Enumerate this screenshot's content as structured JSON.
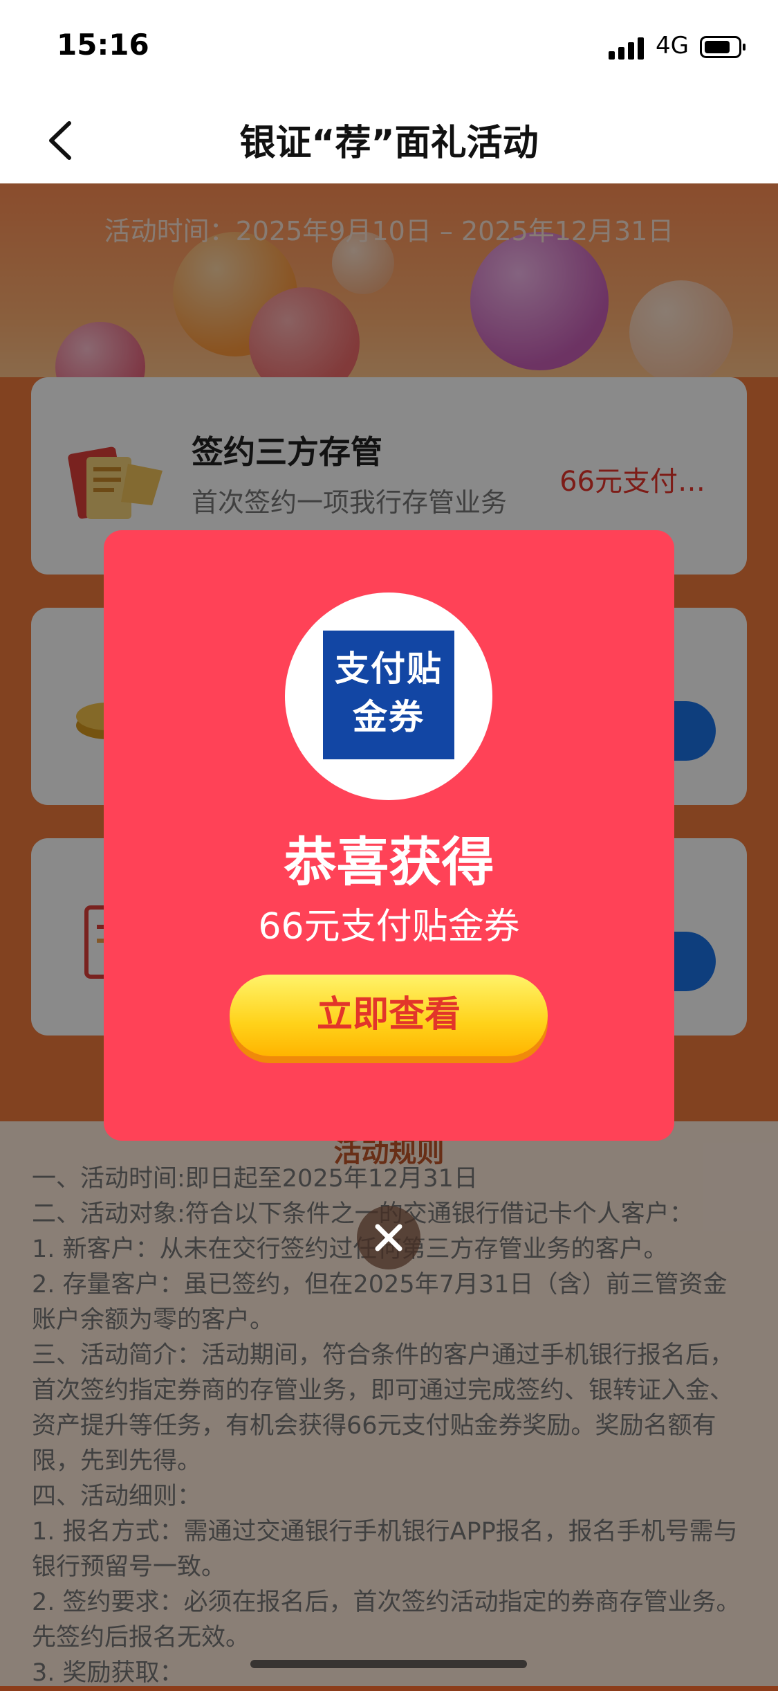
{
  "status_bar": {
    "time": "15:16",
    "network": "4G"
  },
  "nav": {
    "title": "银证“荐”面礼活动"
  },
  "hero": {
    "activity_time": "活动时间：2025年9月10日 – 2025年12月31日"
  },
  "card": {
    "title": "签约三方存管",
    "subtitle": "首次签约一项我行存管业务",
    "reward": "66元支付…"
  },
  "dialog": {
    "coupon_line1": "支付贴",
    "coupon_line2": "金券",
    "heading": "恭喜获得",
    "prize": "66元支付贴金券",
    "view_button": "立即查看"
  },
  "rules": {
    "heading": "活动规则",
    "lines": [
      "一、活动时间:即日起至2025年12月31日",
      "二、活动对象:符合以下条件之一的交通银行借记卡个人客户：",
      "1. 新客户：从未在交行签约过任何第三方存管业务的客户。",
      "2. 存量客户：虽已签约，但在2025年7月31日（含）前三管资金账户余额为零的客户。",
      "三、活动简介：活动期间，符合条件的客户通过手机银行报名后，首次签约指定券商的存管业务，即可通过完成签约、银转证入金、资产提升等任务，有机会获得66元支付贴金券奖励。奖励名额有限，先到先得。",
      "四、活动细则：",
      "1. 报名方式：需通过交通银行手机银行APP报名，报名手机号需与银行预留号一致。",
      "2. 签约要求：必须在报名后，首次签约活动指定的券商存管业务。先签约后报名无效。",
      "3. 奖励获取："
    ]
  },
  "icons": {
    "back": "chevron-left-icon",
    "close": "close-icon",
    "signal": "signal-icon",
    "battery": "battery-icon"
  },
  "colors": {
    "dialog": "#ff4257",
    "button_text": "#e2352a",
    "coupon_bg": "#1246a4",
    "accent_orange": "#f07a3c"
  }
}
